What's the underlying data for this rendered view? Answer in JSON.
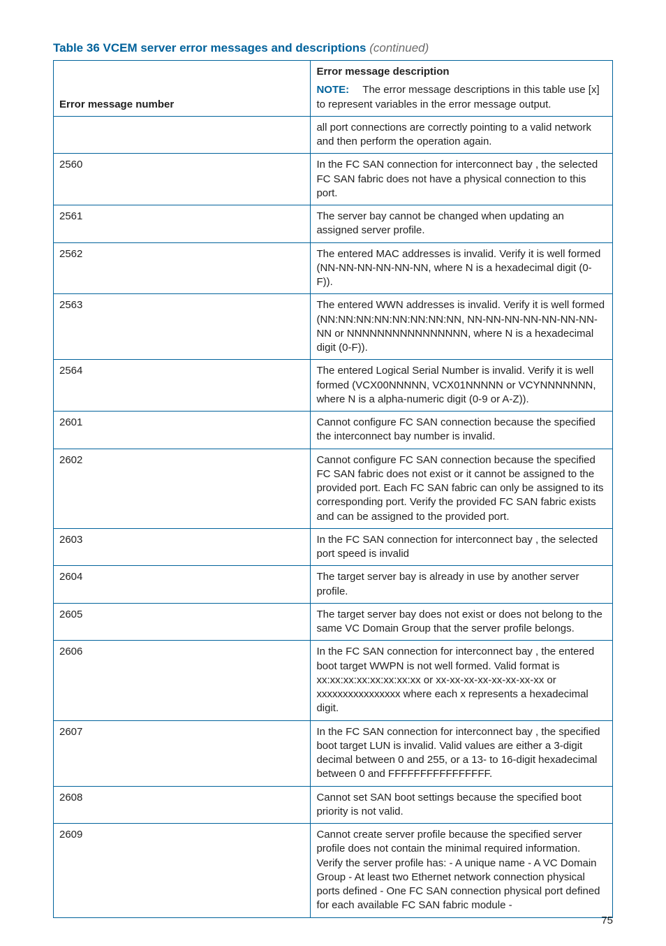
{
  "caption": {
    "main": "Table 36 VCEM server error messages and descriptions",
    "continued": "(continued)"
  },
  "header": {
    "col1": "Error message number",
    "col2_title": "Error message description",
    "note_label": "NOTE:",
    "note_text": "The error message descriptions in this table use [x] to represent variables in the error message output."
  },
  "rows": [
    {
      "num": "",
      "desc": "all port connections are correctly pointing to a valid network and then perform the operation again."
    },
    {
      "num": "2560",
      "desc": "In the FC SAN connection for interconnect bay , the selected FC SAN fabric does not have a physical connection to this port."
    },
    {
      "num": "2561",
      "desc": "The server bay cannot be changed when updating an assigned server profile."
    },
    {
      "num": "2562",
      "desc": "The entered MAC addresses is invalid. Verify it is well formed (NN-NN-NN-NN-NN-NN, where N is a hexadecimal digit (0-F))."
    },
    {
      "num": "2563",
      "desc": "The entered WWN addresses is invalid. Verify it is well formed (NN:NN:NN:NN:NN:NN:NN:NN, NN-NN-NN-NN-NN-NN-NN-NN or NNNNNNNNNNNNNNNN, where N is a hexadecimal digit (0-F))."
    },
    {
      "num": "2564",
      "desc": "The entered Logical Serial Number is invalid. Verify it is well formed (VCX00NNNNN, VCX01NNNNN or VCYNNNNNNN, where N is a alpha-numeric digit (0-9 or A-Z))."
    },
    {
      "num": "2601",
      "desc": "Cannot configure FC SAN connection because the specified the interconnect bay number is invalid."
    },
    {
      "num": "2602",
      "desc": "Cannot configure FC SAN connection because the specified FC SAN fabric does not exist or it cannot be assigned to the provided port. Each FC SAN fabric can only be assigned to its corresponding port. Verify the provided FC SAN fabric exists and can be assigned to the provided port."
    },
    {
      "num": "2603",
      "desc": "In the FC SAN connection for interconnect bay , the selected port speed is invalid"
    },
    {
      "num": "2604",
      "desc": "The target server bay is already in use by another server profile."
    },
    {
      "num": "2605",
      "desc": "The target server bay does not exist or does not belong to the same VC Domain Group that the server profile belongs."
    },
    {
      "num": "2606",
      "desc": "In the FC SAN connection for interconnect bay , the entered boot target WWPN is not well formed. Valid format is xx:xx:xx:xx:xx:xx:xx:xx or xx-xx-xx-xx-xx-xx-xx-xx or xxxxxxxxxxxxxxxx where each x represents a hexadecimal digit."
    },
    {
      "num": "2607",
      "desc": "In the FC SAN connection for interconnect bay , the specified boot target LUN is invalid. Valid values are either a 3-digit decimal between 0 and 255, or a 13- to 16-digit hexadecimal between 0 and FFFFFFFFFFFFFFFF."
    },
    {
      "num": "2608",
      "desc": "Cannot set SAN boot settings because the specified boot priority is not valid."
    },
    {
      "num": "2609",
      "desc": "Cannot create server profile because the specified server profile does not contain the minimal required information. Verify the server profile has: - A unique name - A VC Domain Group - At least two Ethernet network connection physical ports defined - One FC SAN connection physical port defined for each available FC SAN fabric module -"
    }
  ],
  "page_number": "75"
}
